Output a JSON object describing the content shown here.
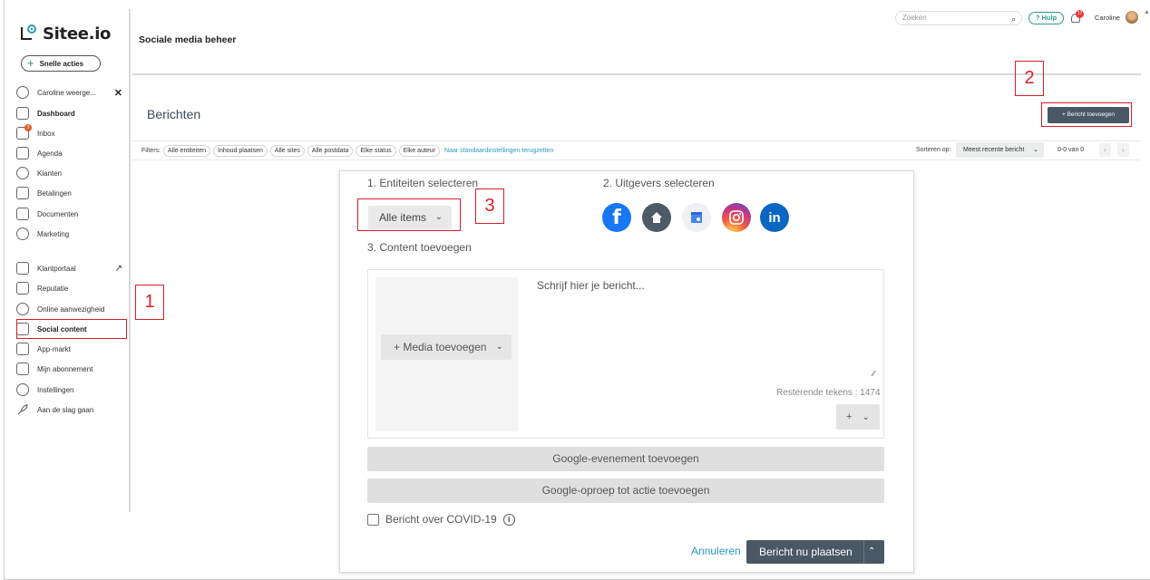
{
  "brand": {
    "name": "Sitee.io"
  },
  "sidebar": {
    "quick_actions": "Snelle acties",
    "user_view": "Caroline weerge...",
    "items": [
      {
        "label": "Dashboard",
        "icon": "dashboard-icon"
      },
      {
        "label": "Inbox",
        "icon": "inbox-icon",
        "badge": "3"
      },
      {
        "label": "Agenda",
        "icon": "calendar-icon"
      },
      {
        "label": "Klanten",
        "icon": "users-icon"
      },
      {
        "label": "Betalingen",
        "icon": "payments-icon"
      },
      {
        "label": "Documenten",
        "icon": "document-icon"
      },
      {
        "label": "Marketing",
        "icon": "target-icon"
      },
      {
        "label": "Klantportaal",
        "icon": "portal-icon"
      },
      {
        "label": "Reputatie",
        "icon": "reputation-icon"
      },
      {
        "label": "Online aanwezigheid",
        "icon": "globe-icon"
      },
      {
        "label": "Social content",
        "icon": "social-icon"
      },
      {
        "label": "App-markt",
        "icon": "store-icon"
      },
      {
        "label": "Mijn abonnement",
        "icon": "clipboard-icon"
      },
      {
        "label": "Instellingen",
        "icon": "gear-icon"
      },
      {
        "label": "Aan de slag gaan",
        "icon": "rocket-icon"
      }
    ]
  },
  "header": {
    "page_title": "Sociale media beheer",
    "search_placeholder": "Zoeken",
    "help": "? Hulp",
    "notifications": "17",
    "user_name": "Caroline"
  },
  "content": {
    "title": "Berichten",
    "add_button": "+ Bericht toevoegen",
    "filters_label": "Filters:",
    "filters": [
      "Alle entiteiten",
      "Inhoud plaatsen",
      "Alle sites",
      "Alle postdata",
      "Elke status",
      "Elke auteur"
    ],
    "reset_link": "Naar standaardinstellingen terugzetten",
    "sort_label": "Sorteren op:",
    "sort_value": "Meest recente bericht",
    "count": "0-0 van 0"
  },
  "modal": {
    "step1": "1. Entiteiten selecteren",
    "step2": "2. Uitgevers selecteren",
    "step3": "3. Content toevoegen",
    "all_items": "Alle items",
    "publishers": [
      "facebook",
      "home",
      "google-business",
      "instagram",
      "linkedin"
    ],
    "media_button": "+ Media toevoegen",
    "message_placeholder": "Schrijf hier je bericht...",
    "remaining": "Resterende tekens : 1474",
    "more_button": "+",
    "google_event": "Google-evenement toevoegen",
    "google_cta": "Google-oproep tot actie toevoegen",
    "covid": "Bericht over COVID-19",
    "cancel": "Annuleren",
    "post_now": "Bericht nu plaatsen"
  },
  "annotations": [
    "1",
    "2",
    "3"
  ],
  "colors": {
    "accent_dark": "#4a5866",
    "annotation_red": "#d81f26",
    "link_blue": "#2a9ac0",
    "facebook": "#1877f2",
    "linkedin": "#0a66c2"
  }
}
